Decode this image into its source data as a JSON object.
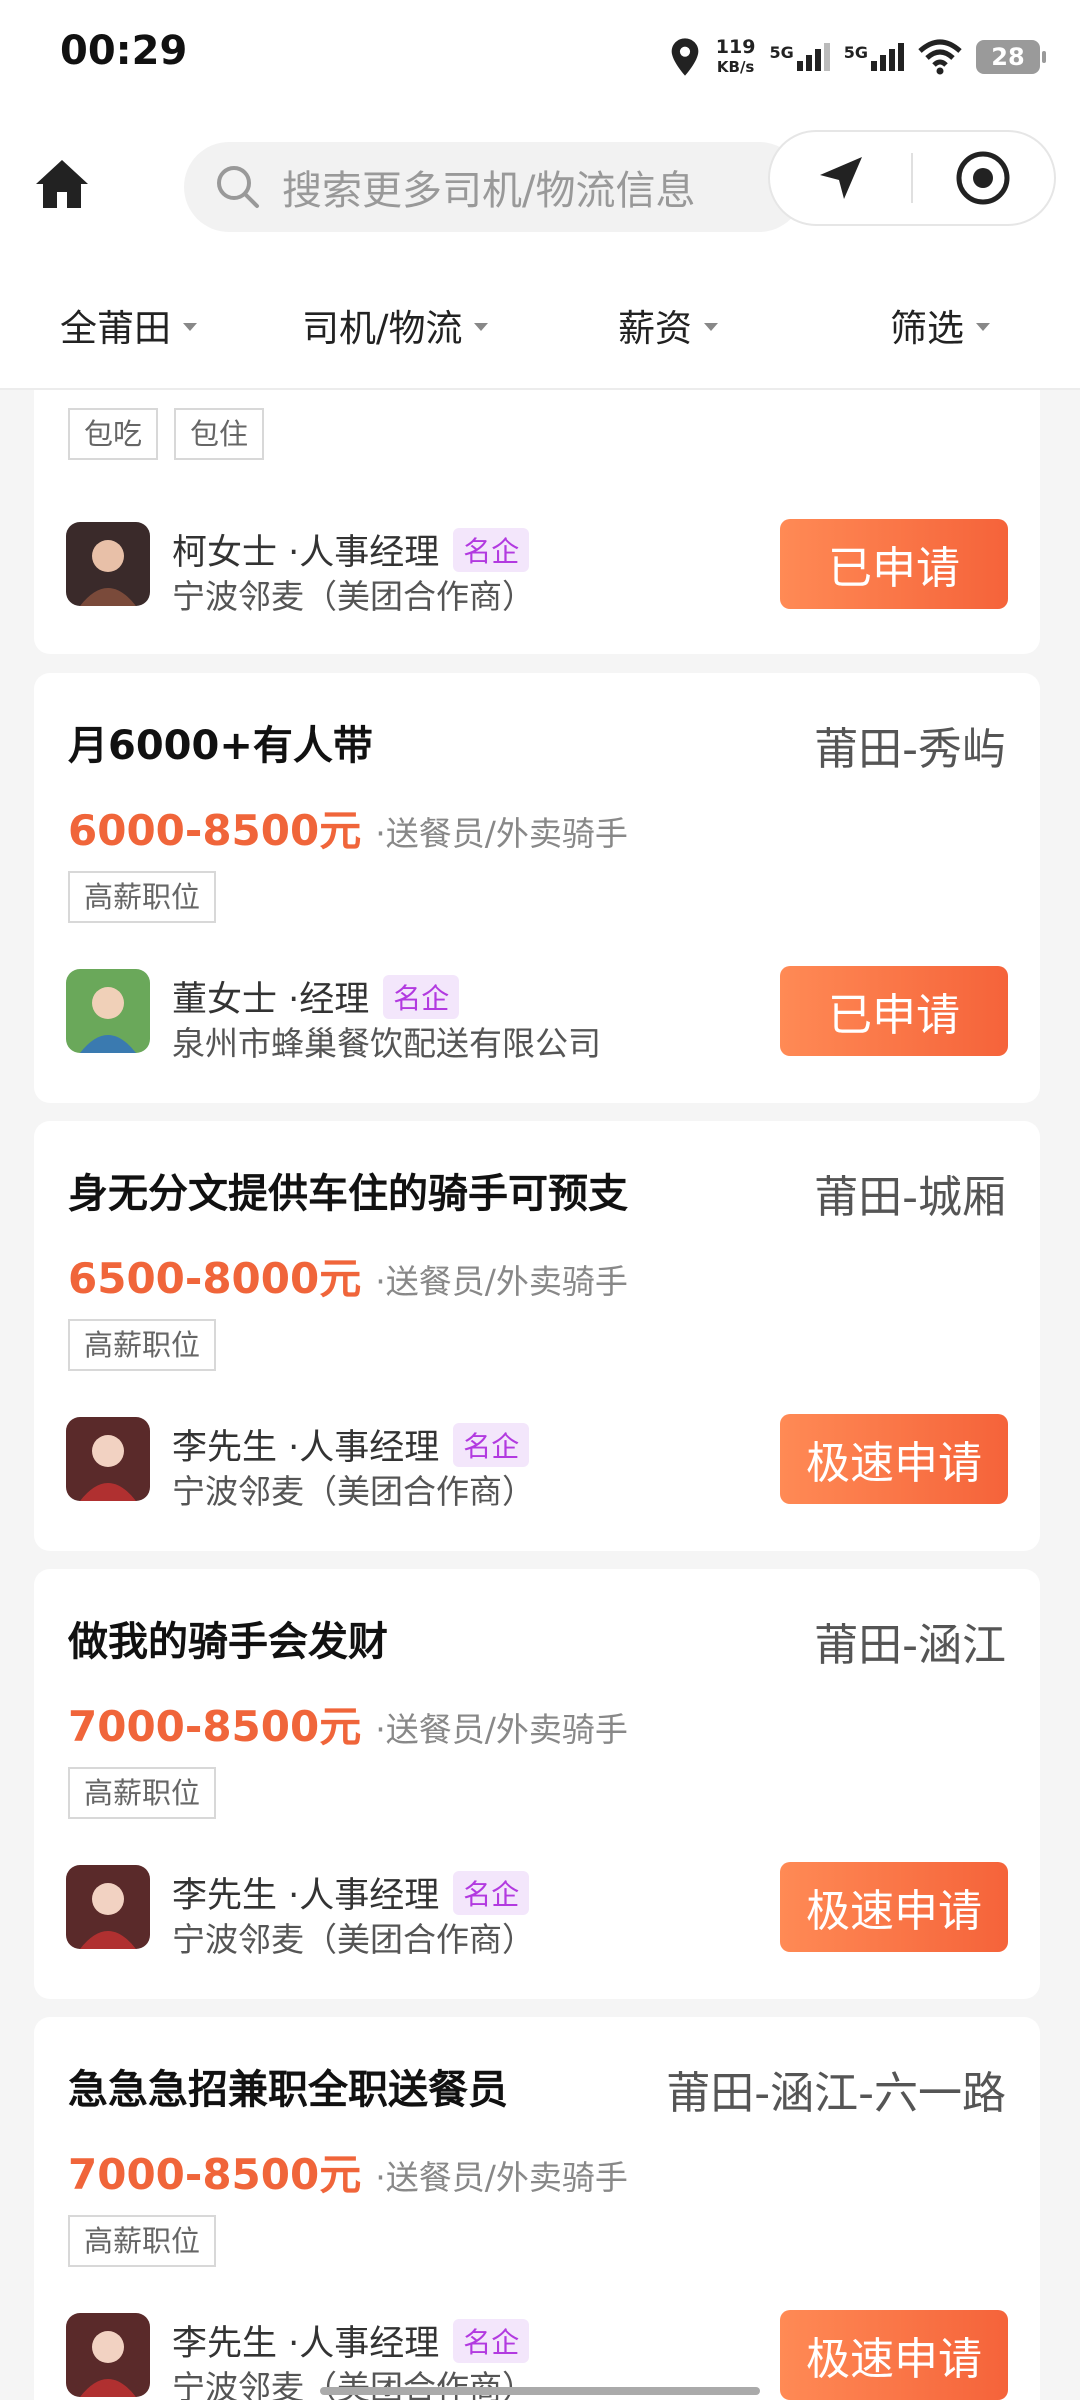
{
  "status_bar": {
    "time": "00:29",
    "net_speed_value": "119",
    "net_speed_unit": "KB/s",
    "sim1": "5G",
    "sim2": "5G",
    "battery": "28",
    "icons": [
      "location-icon",
      "signal-icon",
      "wifi-icon",
      "battery-icon"
    ]
  },
  "header": {
    "search_placeholder": "搜索更多司机/物流信息",
    "icons": [
      "home-icon",
      "search-icon",
      "location-arrow-icon",
      "target-icon"
    ]
  },
  "filters": [
    {
      "label": "全莆田"
    },
    {
      "label": "司机/物流"
    },
    {
      "label": "薪资"
    },
    {
      "label": "筛选"
    }
  ],
  "jobs": [
    {
      "title": "",
      "location": "",
      "salary": "",
      "category": "",
      "tags": [
        "包吃",
        "包住"
      ],
      "contact": "柯女士 ·人事经理",
      "badge": "名企",
      "company": "宁波邻麦（美团合作商）",
      "button": "已申请",
      "avatar_color": "#7a4a3a"
    },
    {
      "title": "月6000+有人带",
      "location": "莆田-秀屿",
      "salary": "6000-8500元",
      "category": "·送餐员/外卖骑手",
      "tags": [
        "高薪职位"
      ],
      "contact": "董女士 ·经理",
      "badge": "名企",
      "company": "泉州市蜂巢餐饮配送有限公司",
      "button": "已申请",
      "avatar_color": "#4a8a4a"
    },
    {
      "title": "身无分文提供车住的骑手可预支",
      "location": "莆田-城厢",
      "salary": "6500-8000元",
      "category": "·送餐员/外卖骑手",
      "tags": [
        "高薪职位"
      ],
      "contact": "李先生 ·人事经理",
      "badge": "名企",
      "company": "宁波邻麦（美团合作商）",
      "button": "极速申请",
      "avatar_color": "#b03030"
    },
    {
      "title": "做我的骑手会发财",
      "location": "莆田-涵江",
      "salary": "7000-8500元",
      "category": "·送餐员/外卖骑手",
      "tags": [
        "高薪职位"
      ],
      "contact": "李先生 ·人事经理",
      "badge": "名企",
      "company": "宁波邻麦（美团合作商）",
      "button": "极速申请",
      "avatar_color": "#b03030"
    },
    {
      "title": "急急急招兼职全职送餐员",
      "location": "莆田-涵江-六一路",
      "salary": "7000-8500元",
      "category": "·送餐员/外卖骑手",
      "tags": [
        "高薪职位"
      ],
      "contact": "李先生 ·人事经理",
      "badge": "名企",
      "company": "宁波邻麦（美团合作商）",
      "button": "极速申请",
      "avatar_color": "#b03030"
    }
  ],
  "colors": {
    "accent": "#f0653a",
    "badge_text": "#b23ae0",
    "badge_bg": "#f3e6fb"
  }
}
